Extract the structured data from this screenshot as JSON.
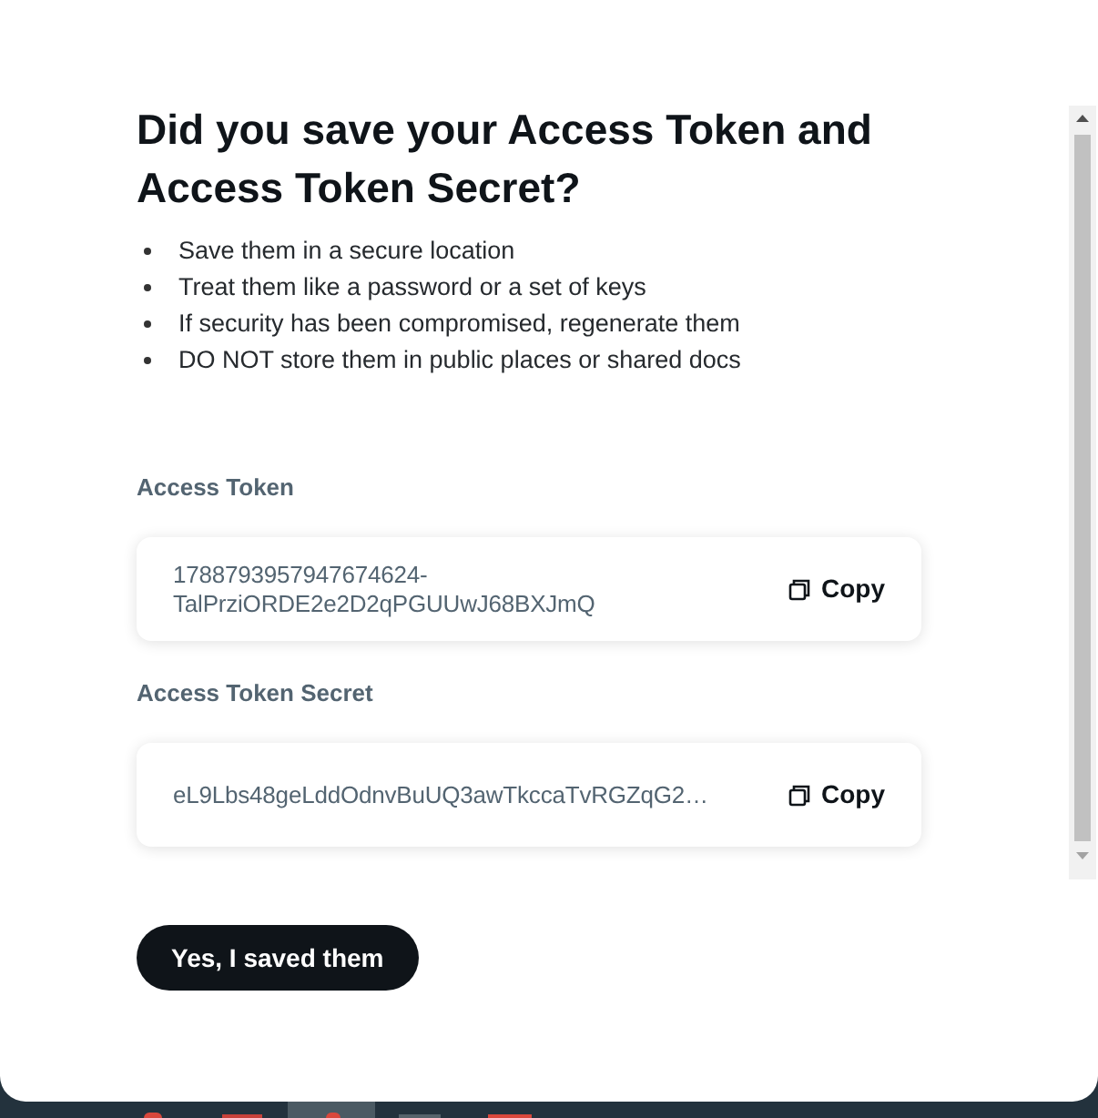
{
  "dialog": {
    "title": "Did you save your Access Token and Access Token Secret?",
    "tips": [
      "Save them in a secure location",
      "Treat them like a password or a set of keys",
      "If security has been compromised, regenerate them",
      "DO NOT store them in public places or shared docs"
    ],
    "fields": [
      {
        "label": "Access Token",
        "value": "1788793957947674624-TalPrziORDE2e2D2qPGUUwJ68BXJmQ",
        "copy_button": "Copy"
      },
      {
        "label": "Access Token Secret",
        "value": "eL9Lbs48geLddOdnvBuUQ3awTkccaTvRGZqG2…",
        "copy_button": "Copy"
      }
    ],
    "confirm_button": "Yes, I saved them"
  }
}
